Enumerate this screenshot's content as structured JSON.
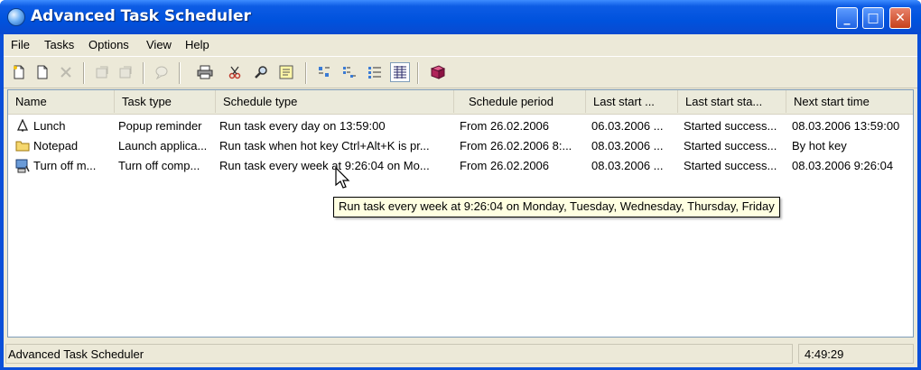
{
  "window": {
    "title": "Advanced Task Scheduler",
    "buttons": {
      "minimize": "_",
      "maximize": "□",
      "close": "✕"
    }
  },
  "menu": [
    "File",
    "Tasks",
    "Options",
    "View",
    "Help"
  ],
  "toolbar": {
    "icons": [
      "new-task-icon",
      "new-document-icon",
      "delete-icon",
      "properties-icon",
      "copy-properties-icon",
      "comment-icon",
      "print-icon",
      "cut-icon",
      "find-icon",
      "notes-icon",
      "large-icons-view-icon",
      "small-icons-view-icon",
      "list-view-icon",
      "details-view-icon",
      "help-book-icon"
    ]
  },
  "table": {
    "columns": [
      "Name",
      "Task type",
      "Schedule type",
      "Schedule period",
      "Last start ...",
      "Last start sta...",
      "Next start time"
    ],
    "rows": [
      {
        "icon": "bell-icon",
        "name": "Lunch",
        "task_type": "Popup reminder",
        "schedule_type": "Run task every day on 13:59:00",
        "schedule_period": "From 26.02.2006",
        "last_start": "06.03.2006 ...",
        "last_status": "Started success...",
        "next_start": "08.03.2006 13:59:00"
      },
      {
        "icon": "folder-icon",
        "name": "Notepad",
        "task_type": "Launch applica...",
        "schedule_type": "Run task when hot key Ctrl+Alt+K is pr...",
        "schedule_period": "From 26.02.2006 8:...",
        "last_start": "08.03.2006 ...",
        "last_status": "Started success...",
        "next_start": "By hot key"
      },
      {
        "icon": "computer-icon",
        "name": "Turn off m...",
        "task_type": "Turn off comp...",
        "schedule_type": "Run task every week at 9:26:04 on Mo...",
        "schedule_period": "From 26.02.2006",
        "last_start": "08.03.2006 ...",
        "last_status": "Started success...",
        "next_start": "08.03.2006 9:26:04"
      }
    ]
  },
  "tooltip": "Run task every week at 9:26:04 on Monday, Tuesday, Wednesday, Thursday, Friday",
  "status": {
    "left": "Advanced Task Scheduler",
    "time": "4:49:29"
  }
}
